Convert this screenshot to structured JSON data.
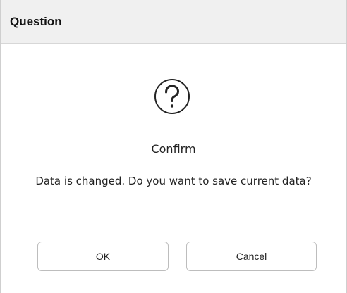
{
  "dialog": {
    "title": "Question",
    "icon": "question-circle-icon",
    "heading": "Confirm",
    "message": "Data is changed. Do you want to save current data?",
    "ok_label": "OK",
    "cancel_label": "Cancel"
  }
}
